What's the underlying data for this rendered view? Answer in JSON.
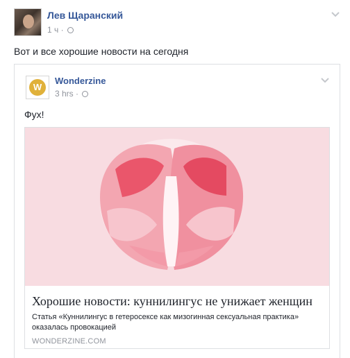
{
  "post": {
    "author": "Лев Щаранский",
    "time": "1 ч",
    "separator": "·",
    "text": "Вот и все хорошие новости на сегодня"
  },
  "shared_post": {
    "page_logo_letter": "W",
    "page_name": "Wonderzine",
    "time": "3 hrs",
    "separator": "·",
    "text": "Фух!",
    "link": {
      "title": "Хорошие новости: куннилингус не унижает женщин",
      "description": "Статья «Куннилингус в гетеросексе как мизогинная сексуальная практика» оказалась провокацией",
      "domain": "WONDERZINE.COM"
    }
  },
  "colors": {
    "link_blue": "#365899",
    "meta_gray": "#90949c",
    "logo_gold": "#e0b13a",
    "image_background": "#f8dce1"
  },
  "icons": [
    "globe-icon",
    "chevron-down-icon",
    "page-logo-icon"
  ]
}
